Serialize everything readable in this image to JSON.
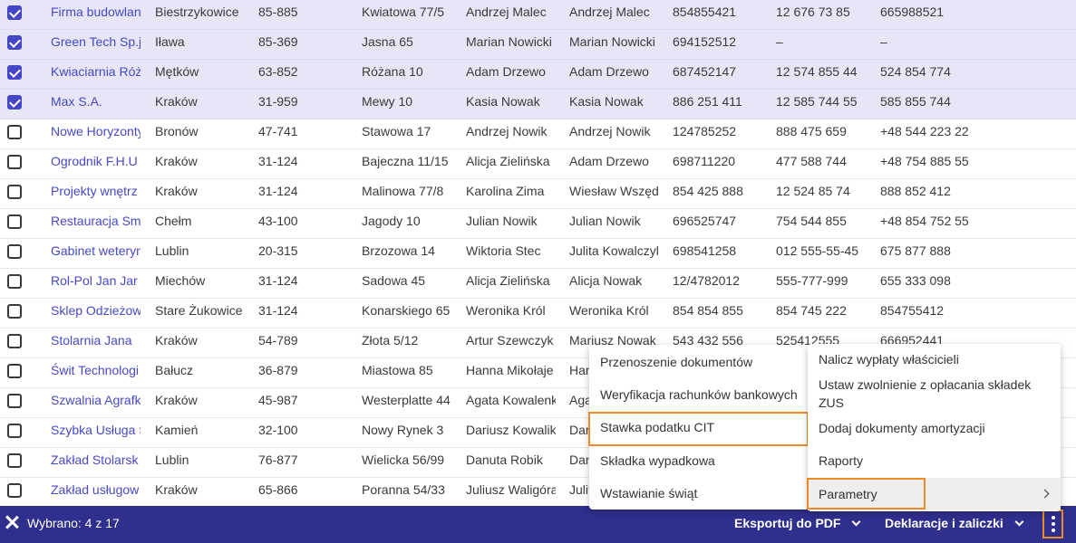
{
  "rows": [
    {
      "checked": true,
      "name": "Firma budowlan",
      "city": "Biestrzykowice",
      "zip": "85-885",
      "street": "Kwiatowa 77/5",
      "person1": "Andrzej Malec",
      "person2": "Andrzej Malec",
      "phone1": "854855421",
      "phone2": "12 676 73 85",
      "phone3": "665988521"
    },
    {
      "checked": true,
      "name": "Green Tech Sp.j",
      "city": "Iława",
      "zip": "85-369",
      "street": "Jasna 65",
      "person1": "Marian Nowicki",
      "person2": "Marian Nowicki",
      "phone1": "694152512",
      "phone2": "–",
      "phone3": "–"
    },
    {
      "checked": true,
      "name": "Kwiaciarnia Róż",
      "city": "Mętków",
      "zip": "63-852",
      "street": "Różana 10",
      "person1": "Adam Drzewo",
      "person2": "Adam Drzewo",
      "phone1": "687452147",
      "phone2": "12 574 855 44",
      "phone3": "524 854 774"
    },
    {
      "checked": true,
      "name": "Max S.A.",
      "city": "Kraków",
      "zip": "31-959",
      "street": "Mewy 10",
      "person1": "Kasia Nowak",
      "person2": "Kasia Nowak",
      "phone1": "886 251 411",
      "phone2": "12 585 744 55",
      "phone3": "585 855 744"
    },
    {
      "checked": false,
      "name": "Nowe Horyzonty",
      "city": "Bronów",
      "zip": "47-741",
      "street": "Stawowa 17",
      "person1": "Andrzej Nowik",
      "person2": "Andrzej Nowik",
      "phone1": "124785252",
      "phone2": "888 475 659",
      "phone3": "+48 544 223 22"
    },
    {
      "checked": false,
      "name": "Ogrodnik F.H.U",
      "city": "Kraków",
      "zip": "31-124",
      "street": "Bajeczna 11/15",
      "person1": "Alicja Zielińska",
      "person2": "Adam Drzewo",
      "phone1": "698711220",
      "phone2": "477 588 744",
      "phone3": "+48 754 885 55"
    },
    {
      "checked": false,
      "name": "Projekty wnętrz",
      "city": "Kraków",
      "zip": "31-124",
      "street": "Malinowa 77/8",
      "person1": "Karolina Zima",
      "person2": "Wiesław Wszęd",
      "phone1": "854 425 888",
      "phone2": "12 524 85 74",
      "phone3": "888 852 412"
    },
    {
      "checked": false,
      "name": "Restauracja Sm",
      "city": "Chełm",
      "zip": "43-100",
      "street": "Jagody 10",
      "person1": "Julian Nowik",
      "person2": "Julian Nowik",
      "phone1": "696525747",
      "phone2": "754 544 855",
      "phone3": "+48 854 752 55"
    },
    {
      "checked": false,
      "name": "Gabinet weteryn",
      "city": "Lublin",
      "zip": "20-315",
      "street": "Brzozowa 14",
      "person1": "Wiktoria Stec",
      "person2": "Julita Kowalczyk",
      "phone1": "698541258",
      "phone2": "012 555-55-45",
      "phone3": "675 877 888"
    },
    {
      "checked": false,
      "name": "Rol-Pol Jan Jar",
      "city": "Miechów",
      "zip": "31-124",
      "street": "Sadowa 45",
      "person1": "Alicja Zielińska",
      "person2": "Alicja Nowak",
      "phone1": "12/4782012",
      "phone2": "555-777-999",
      "phone3": "655 333 098"
    },
    {
      "checked": false,
      "name": "Sklep Odzieżow",
      "city": "Stare Żukowice",
      "zip": "31-124",
      "street": "Konarskiego 65",
      "person1": "Weronika Król",
      "person2": "Weronika Król",
      "phone1": "854 854 855",
      "phone2": "854 745 222",
      "phone3": "854755412"
    },
    {
      "checked": false,
      "name": "Stolarnia Jana",
      "city": "Kraków",
      "zip": "54-789",
      "street": "Złota 5/12",
      "person1": "Artur Szewczyk",
      "person2": "Mariusz Nowak",
      "phone1": "543 432 556",
      "phone2": "525412555",
      "phone3": "666952441"
    },
    {
      "checked": false,
      "name": "Świt Technologi",
      "city": "Bałucz",
      "zip": "36-879",
      "street": "Miastowa 85",
      "person1": "Hanna Mikołaje",
      "person2": "Har",
      "phone1": "",
      "phone2": "",
      "phone3": ""
    },
    {
      "checked": false,
      "name": "Szwalnia Agrafk",
      "city": "Kraków",
      "zip": "45-987",
      "street": "Westerplatte 44",
      "person1": "Agata Kowalenk",
      "person2": "Aga",
      "phone1": "",
      "phone2": "",
      "phone3": ""
    },
    {
      "checked": false,
      "name": "Szybka Usługa S",
      "city": "Kamień",
      "zip": "32-100",
      "street": "Nowy Rynek 3",
      "person1": "Dariusz Kowalik",
      "person2": "Dar",
      "phone1": "",
      "phone2": "",
      "phone3": ""
    },
    {
      "checked": false,
      "name": "Zakład Stolarsk",
      "city": "Lublin",
      "zip": "76-877",
      "street": "Wielicka 56/99",
      "person1": "Danuta Robik",
      "person2": "Dan",
      "phone1": "",
      "phone2": "",
      "phone3": ""
    },
    {
      "checked": false,
      "name": "Zakład usługow",
      "city": "Kraków",
      "zip": "65-866",
      "street": "Poranna 54/33",
      "person1": "Juliusz Waligóra",
      "person2": "Julit",
      "phone1": "",
      "phone2": "",
      "phone3": ""
    }
  ],
  "bottom_bar": {
    "selected_text": "Wybrano: 4 z 17",
    "export_label": "Eksportuj do PDF",
    "declarations_label": "Deklaracje i zaliczki"
  },
  "menu_left": {
    "items": [
      "Przenoszenie dokumentów",
      "Weryfikacja rachunków bankowych",
      "Stawka podatku CIT",
      "Składka wypadkowa",
      "Wstawianie świąt"
    ]
  },
  "menu_right": {
    "items": [
      "Nalicz wypłaty właścicieli",
      "Ustaw zwolnienie z opłacania składek ZUS",
      "Dodaj dokumenty amortyzacji",
      "Raporty",
      "Parametry"
    ]
  },
  "colors": {
    "accent": "#2f2f8e",
    "link": "#4848c8",
    "selected_row": "#e6e6f7",
    "highlight": "#f08a24"
  }
}
